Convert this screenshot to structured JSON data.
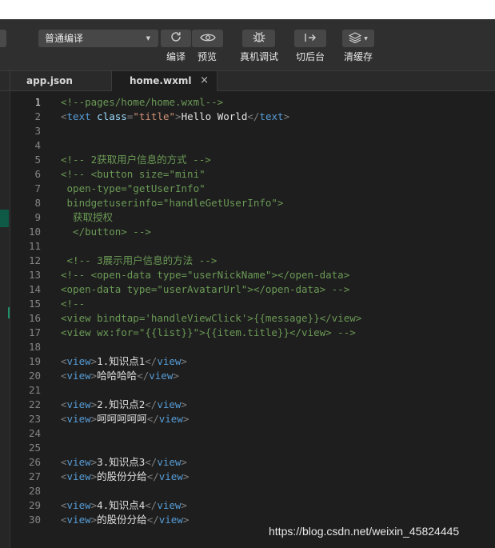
{
  "toolbar": {
    "compile_mode": "普通编译",
    "buttons": [
      {
        "label": "编译",
        "icon": "refresh-icon"
      },
      {
        "label": "预览",
        "icon": "eye-icon"
      },
      {
        "label": "真机调试",
        "icon": "bug-icon"
      },
      {
        "label": "切后台",
        "icon": "switch-background-icon"
      },
      {
        "label": "清缓存",
        "icon": "layers-icon"
      }
    ]
  },
  "tabs": [
    {
      "label": "app.json",
      "active": false
    },
    {
      "label": "home.wxml",
      "active": true,
      "close": "×"
    }
  ],
  "editor": {
    "current_line": 1,
    "lines": [
      {
        "n": "1",
        "tokens": [
          [
            "com",
            "<!--pages/home/home.wxml-->"
          ]
        ]
      },
      {
        "n": "2",
        "tokens": [
          [
            "punc",
            "<"
          ],
          [
            "tag",
            "text"
          ],
          [
            "text",
            " "
          ],
          [
            "attr",
            "class"
          ],
          [
            "punc",
            "="
          ],
          [
            "str",
            "\"title\""
          ],
          [
            "punc",
            ">"
          ],
          [
            "text",
            "Hello World"
          ],
          [
            "punc",
            "</"
          ],
          [
            "tag",
            "text"
          ],
          [
            "punc",
            ">"
          ]
        ]
      },
      {
        "n": "3",
        "tokens": []
      },
      {
        "n": "4",
        "tokens": []
      },
      {
        "n": "5",
        "tokens": [
          [
            "com",
            "<!-- 2获取用户信息的方式 -->"
          ]
        ]
      },
      {
        "n": "6",
        "tokens": [
          [
            "com",
            "<!-- <button size=\"mini\""
          ]
        ]
      },
      {
        "n": "7",
        "tokens": [
          [
            "com",
            " open-type=\"getUserInfo\""
          ]
        ]
      },
      {
        "n": "8",
        "tokens": [
          [
            "com",
            " bindgetuserinfo=\"handleGetUserInfo\">"
          ]
        ]
      },
      {
        "n": "9",
        "tokens": [
          [
            "com",
            "  获取授权"
          ]
        ]
      },
      {
        "n": "10",
        "tokens": [
          [
            "com",
            "  </button> -->"
          ]
        ]
      },
      {
        "n": "11",
        "tokens": []
      },
      {
        "n": "12",
        "tokens": [
          [
            "com",
            " <!-- 3展示用户信息的方法 -->"
          ]
        ]
      },
      {
        "n": "13",
        "tokens": [
          [
            "com",
            "<!-- <open-data type=\"userNickName\"></open-data>"
          ]
        ]
      },
      {
        "n": "14",
        "tokens": [
          [
            "com",
            "<open-data type=\"userAvatarUrl\"></open-data> -->"
          ]
        ]
      },
      {
        "n": "15",
        "tokens": [
          [
            "com",
            "<!--"
          ]
        ]
      },
      {
        "n": "16",
        "tokens": [
          [
            "com",
            "<view bindtap='handleViewClick'>{{message}}</view>"
          ]
        ]
      },
      {
        "n": "17",
        "tokens": [
          [
            "com",
            "<view wx:for=\"{{list}}\">{{item.title}}</view> -->"
          ]
        ]
      },
      {
        "n": "18",
        "tokens": []
      },
      {
        "n": "19",
        "tokens": [
          [
            "punc",
            "<"
          ],
          [
            "tag",
            "view"
          ],
          [
            "punc",
            ">"
          ],
          [
            "text",
            "1.知识点1"
          ],
          [
            "punc",
            "</"
          ],
          [
            "tag",
            "view"
          ],
          [
            "punc",
            ">"
          ]
        ]
      },
      {
        "n": "20",
        "tokens": [
          [
            "punc",
            "<"
          ],
          [
            "tag",
            "view"
          ],
          [
            "punc",
            ">"
          ],
          [
            "text",
            "哈哈哈哈"
          ],
          [
            "punc",
            "</"
          ],
          [
            "tag",
            "view"
          ],
          [
            "punc",
            ">"
          ]
        ]
      },
      {
        "n": "21",
        "tokens": []
      },
      {
        "n": "22",
        "tokens": [
          [
            "punc",
            "<"
          ],
          [
            "tag",
            "view"
          ],
          [
            "punc",
            ">"
          ],
          [
            "text",
            "2.知识点2"
          ],
          [
            "punc",
            "</"
          ],
          [
            "tag",
            "view"
          ],
          [
            "punc",
            ">"
          ]
        ]
      },
      {
        "n": "23",
        "tokens": [
          [
            "punc",
            "<"
          ],
          [
            "tag",
            "view"
          ],
          [
            "punc",
            ">"
          ],
          [
            "text",
            "呵呵呵呵呵"
          ],
          [
            "punc",
            "</"
          ],
          [
            "tag",
            "view"
          ],
          [
            "punc",
            ">"
          ]
        ]
      },
      {
        "n": "24",
        "tokens": []
      },
      {
        "n": "25",
        "tokens": []
      },
      {
        "n": "26",
        "tokens": [
          [
            "punc",
            "<"
          ],
          [
            "tag",
            "view"
          ],
          [
            "punc",
            ">"
          ],
          [
            "text",
            "3.知识点3"
          ],
          [
            "punc",
            "</"
          ],
          [
            "tag",
            "view"
          ],
          [
            "punc",
            ">"
          ]
        ]
      },
      {
        "n": "27",
        "tokens": [
          [
            "punc",
            "<"
          ],
          [
            "tag",
            "view"
          ],
          [
            "punc",
            ">"
          ],
          [
            "text",
            "的股份分给"
          ],
          [
            "punc",
            "</"
          ],
          [
            "tag",
            "view"
          ],
          [
            "punc",
            ">"
          ]
        ]
      },
      {
        "n": "28",
        "tokens": []
      },
      {
        "n": "29",
        "tokens": [
          [
            "punc",
            "<"
          ],
          [
            "tag",
            "view"
          ],
          [
            "punc",
            ">"
          ],
          [
            "text",
            "4.知识点4"
          ],
          [
            "punc",
            "</"
          ],
          [
            "tag",
            "view"
          ],
          [
            "punc",
            ">"
          ]
        ]
      },
      {
        "n": "30",
        "tokens": [
          [
            "punc",
            "<"
          ],
          [
            "tag",
            "view"
          ],
          [
            "punc",
            ">"
          ],
          [
            "text",
            "的股份分给"
          ],
          [
            "punc",
            "</"
          ],
          [
            "tag",
            "view"
          ],
          [
            "punc",
            ">"
          ]
        ]
      }
    ]
  },
  "watermark": "https://blog.csdn.net/weixin_45824445"
}
